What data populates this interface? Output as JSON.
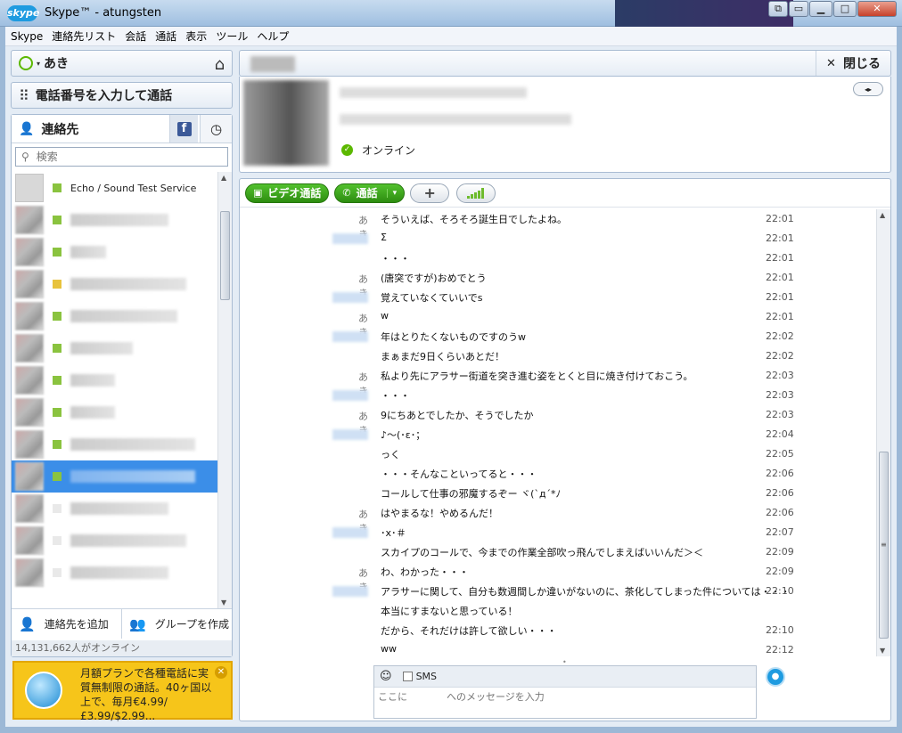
{
  "window": {
    "title": "Skype™ - atungsten",
    "logo_text": "skype",
    "buttons": {
      "minimize": "▁",
      "maximize": "□",
      "close": "✕",
      "restore": "⧉",
      "pin": "▭"
    }
  },
  "menu": [
    "Skype",
    "連絡先リスト",
    "会話",
    "通話",
    "表示",
    "ツール",
    "ヘルプ"
  ],
  "status": {
    "name": "あき",
    "caret": "▾",
    "home_icon": "⌂"
  },
  "dial": {
    "label": "電話番号を入力して通話",
    "icon": "⠿"
  },
  "contacts": {
    "tab_label": "連絡先",
    "person_icon": "👤",
    "facebook_icon": "f",
    "recent_icon": "◷",
    "search_placeholder": "検索",
    "search_icon": "⚲",
    "first_contact": "Echo / Sound Test Service",
    "add_contact": "連絡先を追加",
    "create_group": "グループを作成",
    "add_contact_icon": "👤",
    "create_group_icon": "👥",
    "online_count": "14,131,662人がオンライン"
  },
  "promo": {
    "text": "月額プランで各種電話に実質無制限の通話。40ヶ国以上で、毎月€4.99/£3.99/$2.99...",
    "close": "✕"
  },
  "conversation": {
    "close_label": "閉じる",
    "close_icon": "✕",
    "status": "オンライン",
    "status_icon": "✓",
    "video_call": "ビデオ通話",
    "call": "通話",
    "video_icon": "▣",
    "call_icon": "✆",
    "call_dropdown": "▾",
    "add_icon": "+",
    "sms_label": "SMS",
    "message_placeholder": "ここに　　　　へのメッセージを入力",
    "send_icon": "●",
    "smile_icon": "☺",
    "arrows": "◂▸"
  },
  "messages": [
    {
      "who": "あき",
      "text": "そういえば、そろそろ誕生日でしたよね。",
      "time": "22:01"
    },
    {
      "who": "",
      "text": "Σ",
      "time": "22:01"
    },
    {
      "who": "",
      "text": "・・・",
      "time": "22:01"
    },
    {
      "who": "あき",
      "text": "(唐突ですが)おめでとう",
      "time": "22:01"
    },
    {
      "who": "",
      "text": "覚えていなくていいでs",
      "time": "22:01"
    },
    {
      "who": "あき",
      "text": "w",
      "time": "22:01"
    },
    {
      "who": "",
      "text": "年はとりたくないものですのうw",
      "time": "22:02"
    },
    {
      "who": "",
      "text": "まぁまだ9日くらいあとだ！",
      "time": "22:02"
    },
    {
      "who": "あき",
      "text": "私より先にアラサー街道を突き進む姿をとくと目に焼き付けておこう。",
      "time": "22:03"
    },
    {
      "who": "",
      "text": "・・・",
      "time": "22:03"
    },
    {
      "who": "あき",
      "text": "9にちあとでしたか、そうでしたか",
      "time": "22:03"
    },
    {
      "who": "",
      "text": "♪～(･ε･；",
      "time": "22:04"
    },
    {
      "who": "",
      "text": "っく",
      "time": "22:05"
    },
    {
      "who": "",
      "text": "・・・そんなこといってると・・・",
      "time": "22:06"
    },
    {
      "who": "",
      "text": "コールして仕事の邪魔するぞー ヾ(`д´*ﾉ",
      "time": "22:06"
    },
    {
      "who": "あき",
      "text": "はやまるな！やめるんだ！",
      "time": "22:06"
    },
    {
      "who": "",
      "text": "･x･＃",
      "time": "22:07"
    },
    {
      "who": "",
      "text": "スカイプのコールで、今までの作業全部吹っ飛んでしまえばいいんだ＞＜",
      "time": "22:09"
    },
    {
      "who": "あき",
      "text": "わ、わかった・・・",
      "time": "22:09"
    },
    {
      "who": "",
      "text": "アラサーに関して、自分も数週間しか違いがないのに、茶化してしまった件については・・・",
      "time": "22:10"
    },
    {
      "who": "",
      "text": "本当にすまないと思っている！",
      "time": ""
    },
    {
      "who": "",
      "text": "だから、それだけは許して欲しい・・・",
      "time": "22:10"
    },
    {
      "who": "",
      "text": "ww",
      "time": "22:12"
    }
  ]
}
